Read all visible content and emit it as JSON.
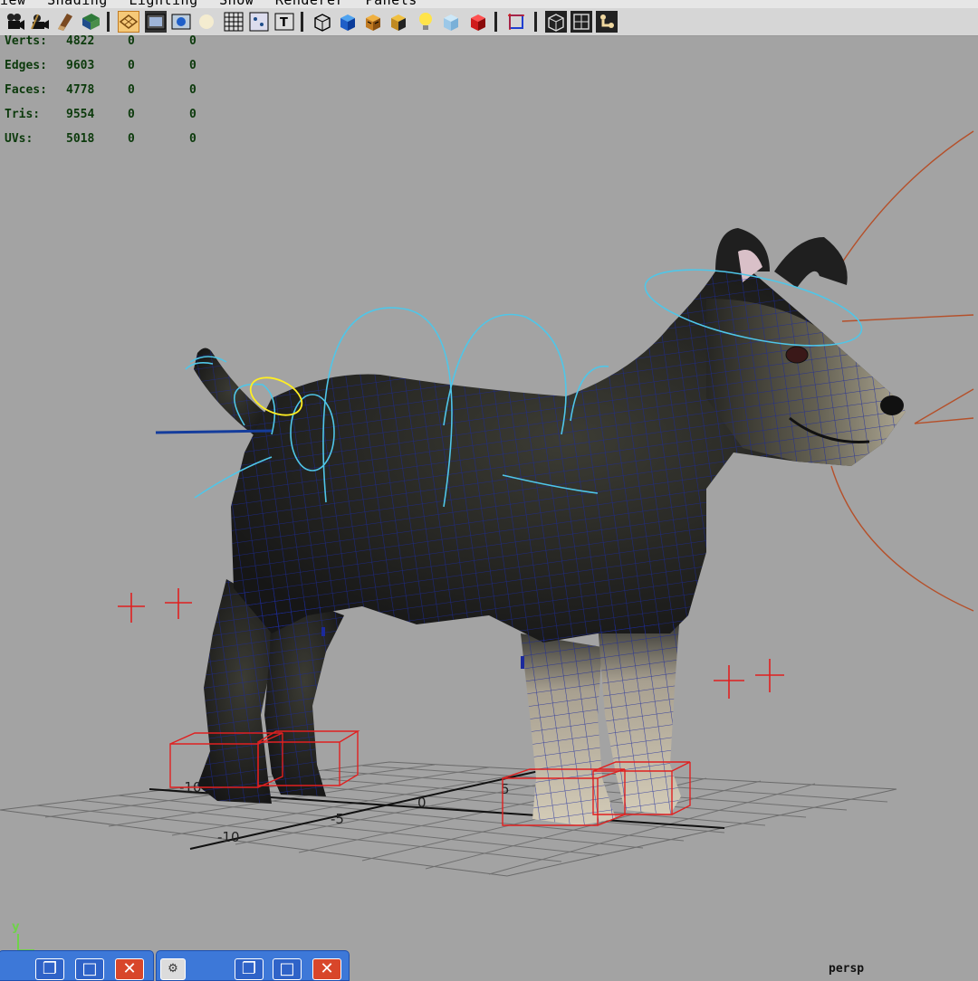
{
  "menubar": {
    "items": [
      "iew",
      "Shading",
      "Lighting",
      "Show",
      "Renderer",
      "Panels"
    ]
  },
  "toolbar": {
    "icons": [
      "select-camera-icon",
      "camera-attributes-icon",
      "bookmark-icon",
      "image-plane-icon",
      "grid-toggle-icon",
      "film-gate-icon",
      "resolution-gate-icon",
      "safe-action-icon",
      "grid-display-icon",
      "field-chart-icon",
      "safe-title-icon",
      "wireframe-icon",
      "smooth-shade-icon",
      "texture-icon",
      "shadow-icon",
      "lights-icon",
      "xray-icon",
      "isolate-select-icon",
      "frame-all-icon",
      "bounding-box-icon",
      "wireframe-on-shaded-icon",
      "joint-xray-icon"
    ]
  },
  "hud": {
    "rows": [
      {
        "label": "Verts:",
        "v1": "4822",
        "v2": "0",
        "v3": "0"
      },
      {
        "label": "Edges:",
        "v1": "9603",
        "v2": "0",
        "v3": "0"
      },
      {
        "label": "Faces:",
        "v1": "4778",
        "v2": "0",
        "v3": "0"
      },
      {
        "label": "Tris:",
        "v1": "9554",
        "v2": "0",
        "v3": "0"
      },
      {
        "label": "UVs:",
        "v1": "5018",
        "v2": "0",
        "v3": "0"
      }
    ]
  },
  "grid": {
    "labels": [
      "-10",
      "-5",
      "0",
      "5",
      "-10"
    ]
  },
  "axis": {
    "y_label": "y"
  },
  "camera": {
    "label": "persp"
  },
  "taskbar": {
    "buttons": [
      "restore-icon",
      "maximize-icon",
      "close-icon"
    ]
  },
  "colors": {
    "viewport_bg": "#a3a3a3",
    "wire": "#1c2a9c",
    "control_curve": "#4fc6e8",
    "selected_curve": "#ffee22",
    "locator": "#e02020",
    "ik_arc": "#b5502a"
  }
}
